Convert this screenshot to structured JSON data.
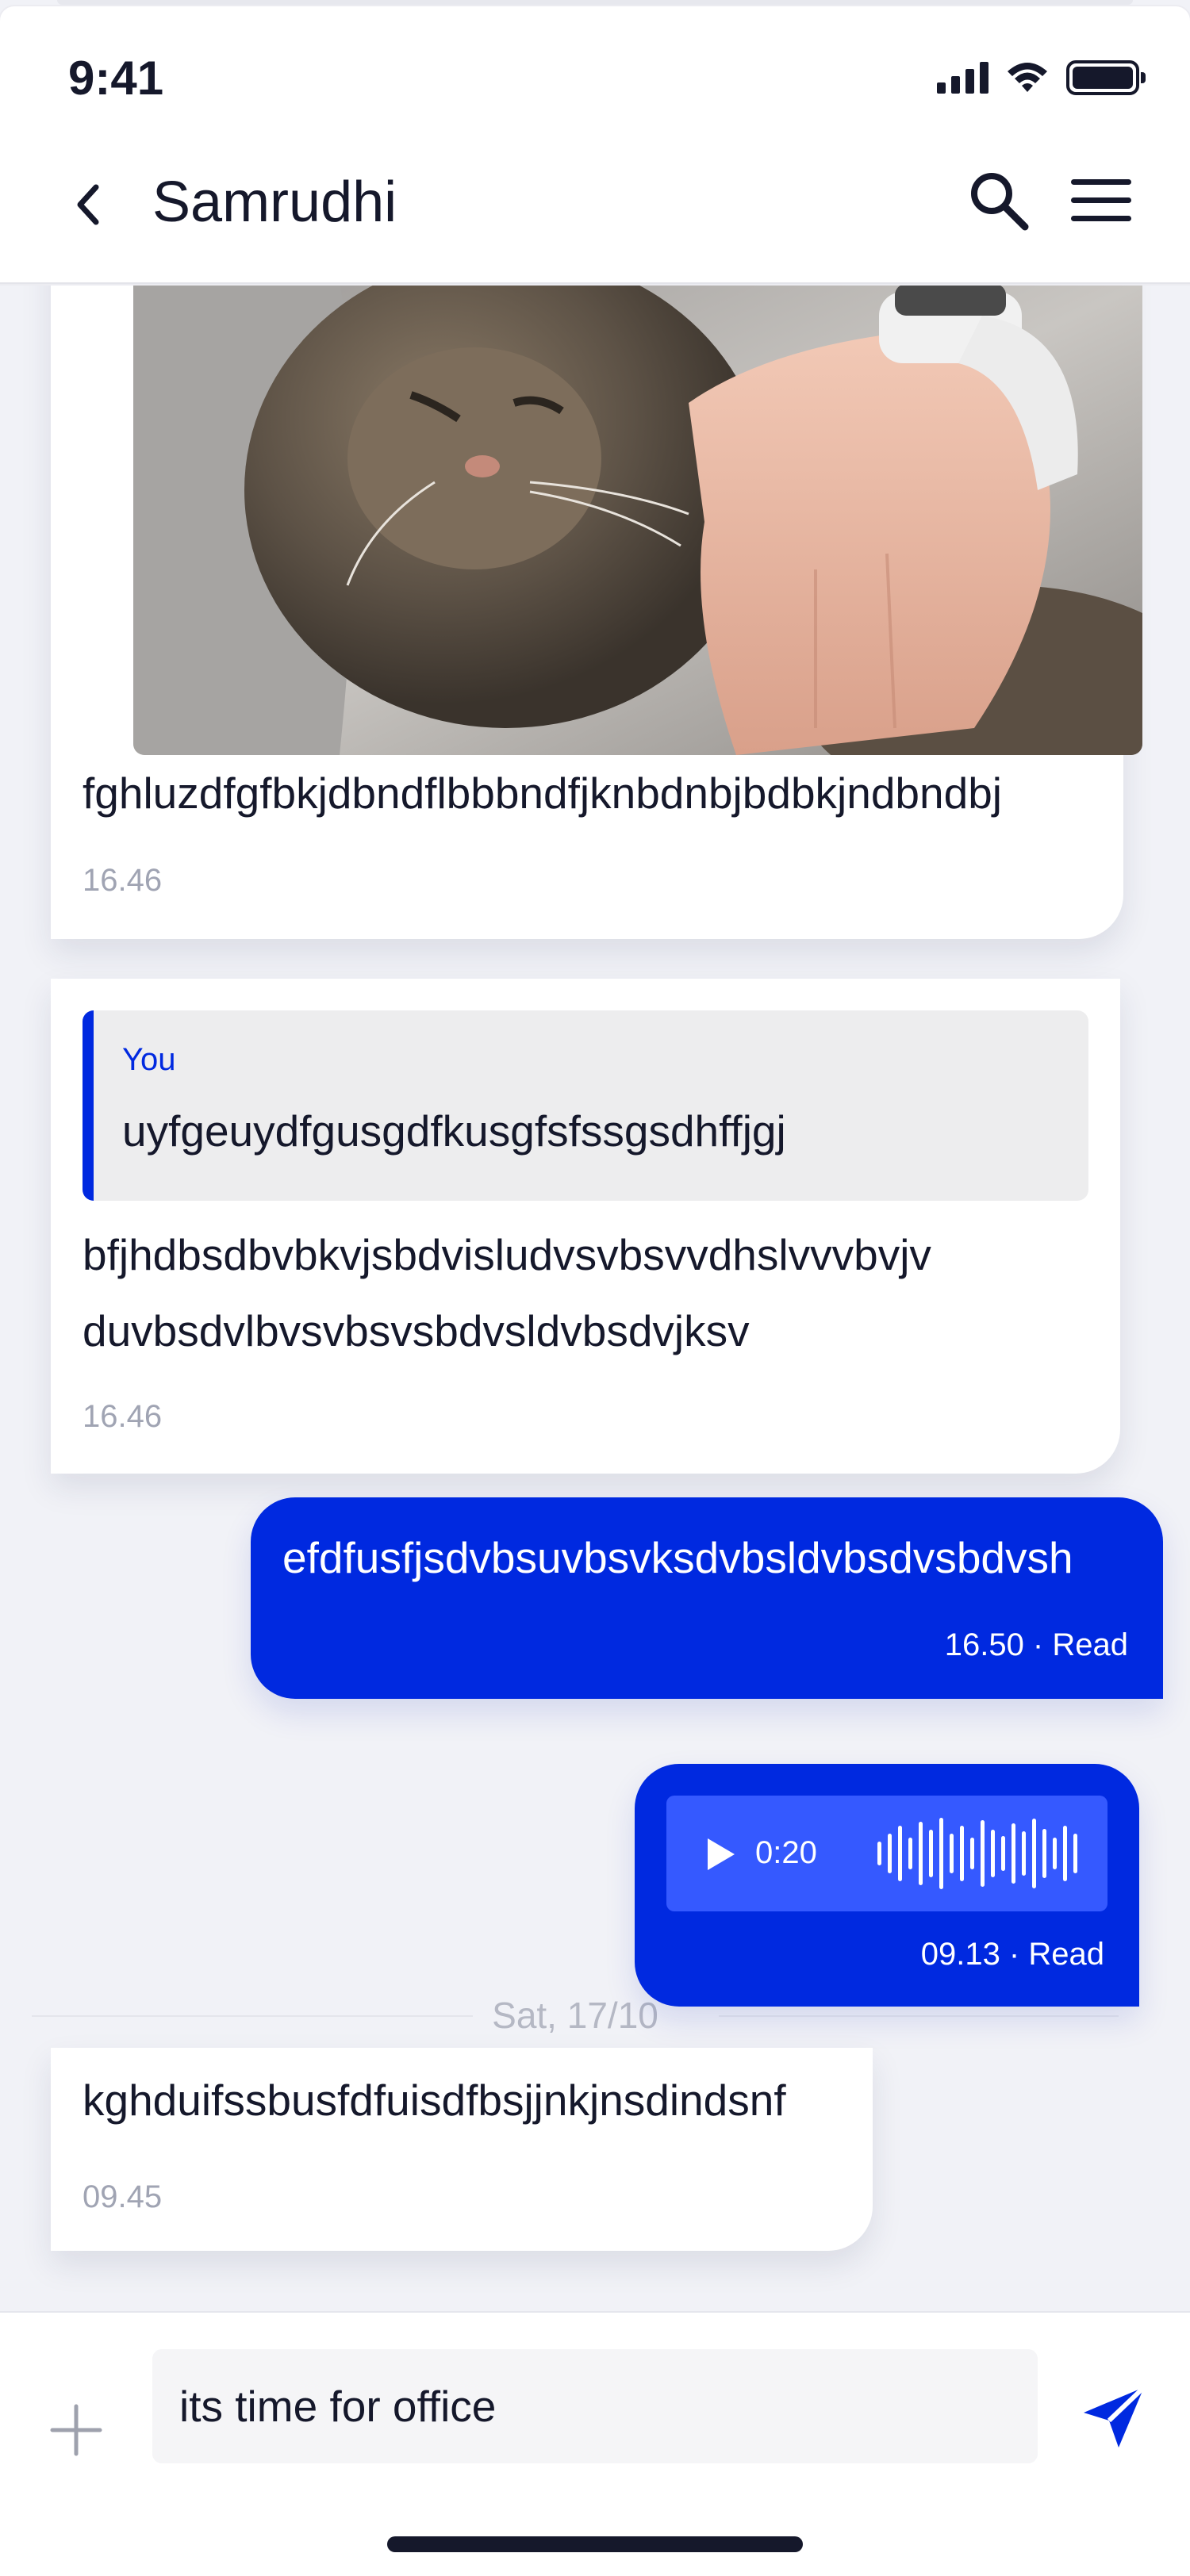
{
  "status_bar": {
    "time": "9:41"
  },
  "header": {
    "title": "Samrudhi"
  },
  "messages": [
    {
      "type": "image",
      "direction": "incoming",
      "text": "fghluzdfgfbkjdbndflbbbndfjknbdnbjbdbkjndbndbj",
      "time": "16.46"
    },
    {
      "type": "reply",
      "direction": "incoming",
      "reply_author": "You",
      "reply_text": "uyfgeuydfgusgdfkusgfsfssgsdhffjgj",
      "text_line1": "bfjhdbsdbvbkvjsbdvisludvsvbsvvdhslvvvbvjv",
      "text_line2": "duvbsdvlbvsvbsvsbdvsldvbsdvjksv",
      "time": "16.46"
    },
    {
      "type": "text",
      "direction": "outgoing",
      "text": "efdfusfjsdvbsuvbsvksdvbsldvbsdvsbdvsh",
      "meta": "16.50 · Read"
    },
    {
      "type": "date",
      "label": "Sat, 17/10"
    },
    {
      "type": "audio",
      "direction": "outgoing",
      "duration": "0:20",
      "meta": "09.13 · Read"
    },
    {
      "type": "text",
      "direction": "incoming",
      "text": "kghduifssbusfdfuisdfbsjjnkjnsdindsnf",
      "time": "09.45"
    }
  ],
  "composer": {
    "value": "its time for office"
  },
  "colors": {
    "accent": "#0029e0",
    "audio_box": "#3559ff",
    "background": "#f1f2f7",
    "text": "#15182b",
    "muted": "#a0a4b3"
  },
  "icons": [
    "back-chevron-icon",
    "search-icon",
    "menu-icon",
    "play-icon",
    "waveform-icon",
    "plus-icon",
    "send-icon",
    "signal-icon",
    "wifi-icon",
    "battery-icon"
  ]
}
